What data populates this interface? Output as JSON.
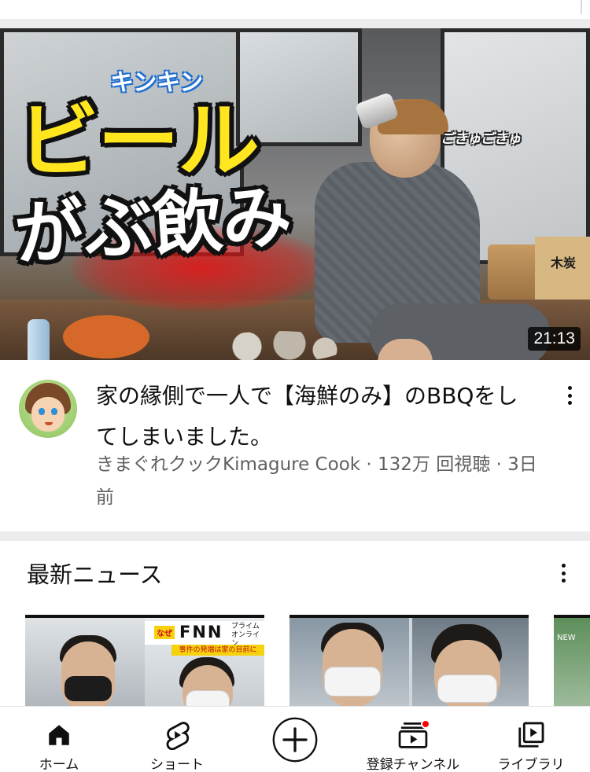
{
  "video": {
    "thumbnail_caption_main": "ビール",
    "thumbnail_caption_small": "キンキン",
    "thumbnail_caption_sub": "がぶ飲み",
    "thumbnail_caption_side": "ごきゅごきゅ",
    "thumbnail_box_label": "木炭",
    "duration": "21:13",
    "title": "家の縁側で一人で【海鮮のみ】のBBQをしてしまいました。",
    "meta_line": "きまぐれクックKimagure Cook · 132万 回視聴 · 3日前"
  },
  "news_shelf": {
    "title": "最新ニュース",
    "card1": {
      "badge": "なぜ",
      "logo": "FNN",
      "logo_side": "プライム オンライン",
      "strip": "事件の発端は家の目前に"
    },
    "card3": {
      "label": "NEW"
    }
  },
  "bottom_nav": {
    "items": [
      {
        "label": "ホーム",
        "icon": "home-icon"
      },
      {
        "label": "ショート",
        "icon": "shorts-icon"
      },
      {
        "label": "",
        "icon": "create-icon"
      },
      {
        "label": "登録チャンネル",
        "icon": "subscriptions-icon",
        "has_notification_dot": true
      },
      {
        "label": "ライブラリ",
        "icon": "library-icon"
      }
    ]
  },
  "colors": {
    "text_primary": "#0f0f0f",
    "text_secondary": "#606060",
    "separator": "#ececec",
    "notification_dot": "#ff0000",
    "caption_yellow": "#ffe61f"
  }
}
